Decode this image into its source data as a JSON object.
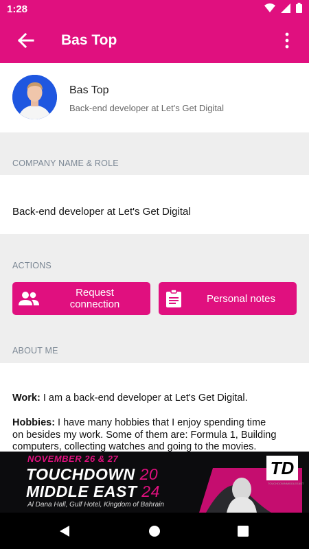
{
  "status_bar": {
    "time": "1:28"
  },
  "app_bar": {
    "title": "Bas Top"
  },
  "profile": {
    "name": "Bas Top",
    "subtitle": "Back-end developer at Let's Get Digital"
  },
  "company_section": {
    "label": "COMPANY NAME & ROLE",
    "value": "Back-end developer at Let's Get Digital"
  },
  "actions_section": {
    "label": "ACTIONS",
    "request_line1": "Request",
    "request_line2": "connection",
    "notes_label": "Personal notes"
  },
  "about_section": {
    "label": "ABOUT ME",
    "work_key": "Work:",
    "work_value": " I am a back-end developer at Let's Get Digital.",
    "hobbies_key": "Hobbies:",
    "hobbies_line1": " I have many hobbies that I enjoy spending time",
    "hobbies_line2": "on besides my work. Some of them are: Formula 1, Building",
    "hobbies_line3": "computers, collecting watches and going to the movies."
  },
  "ad": {
    "date": "NOVEMBER 26 & 27",
    "line1": "TOUCHDOWN",
    "year1": "20",
    "line2": "MIDDLE EAST",
    "year2": "24",
    "venue": "Al Dana Hall, Gulf Hotel, Kingdom of Bahrain",
    "logo": "TD",
    "logo_sub": "TOUCHDOWNMIDDLEEAST"
  },
  "colors": {
    "accent": "#e0107f",
    "background": "#eeeeee"
  }
}
